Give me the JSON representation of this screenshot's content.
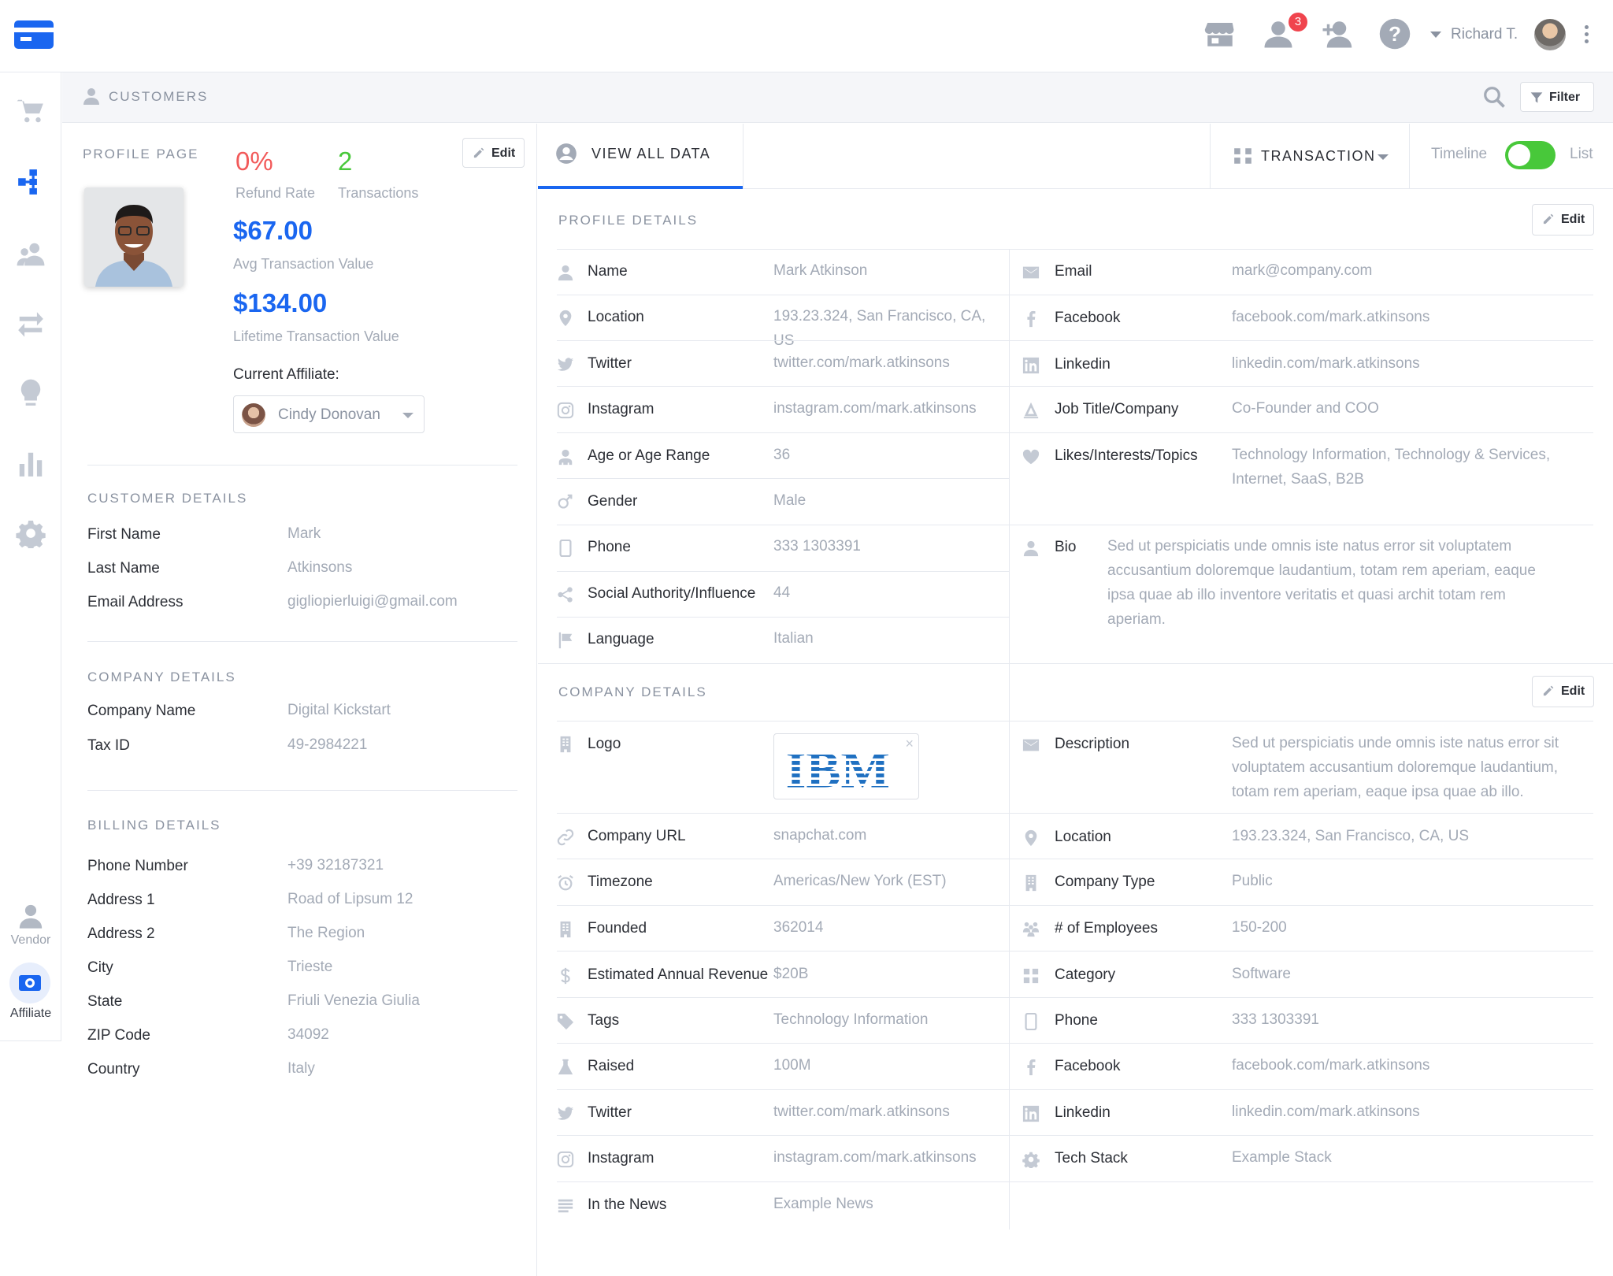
{
  "header": {
    "notifications_count": "3",
    "user_name": "Richard T."
  },
  "subheader": {
    "title": "CUSTOMERS",
    "filter_label": "Filter"
  },
  "sidebar": {
    "vendor_label": "Vendor",
    "affiliate_label": "Affiliate",
    "accent_color": "#1a66f0"
  },
  "profile": {
    "section_title": "PROFILE PAGE",
    "edit_label": "Edit",
    "refund_rate": "0%",
    "refund_rate_label": "Refund Rate",
    "transactions": "2",
    "transactions_label": "Transactions",
    "avg_value": "$67.00",
    "avg_label": "Avg Transaction Value",
    "lifetime_value": "$134.00",
    "lifetime_label": "Lifetime Transaction Value",
    "affiliate_title": "Current Affiliate:",
    "affiliate_name": "Cindy Donovan"
  },
  "customer_details": {
    "title": "CUSTOMER DETAILS",
    "rows": [
      {
        "label": "First Name",
        "value": "Mark"
      },
      {
        "label": "Last Name",
        "value": "Atkinsons"
      },
      {
        "label": "Email Address",
        "value": "gigliopierluigi@gmail.com"
      }
    ]
  },
  "company_details_left": {
    "title": "COMPANY DETAILS",
    "rows": [
      {
        "label": "Company Name",
        "value": "Digital Kickstart"
      },
      {
        "label": "Tax ID",
        "value": "49-2984221"
      }
    ]
  },
  "billing_details": {
    "title": "BILLING DETAILS",
    "rows": [
      {
        "label": "Phone Number",
        "value": "+39 32187321"
      },
      {
        "label": "Address 1",
        "value": "Road of Lipsum 12"
      },
      {
        "label": "Address 2",
        "value": "The Region"
      },
      {
        "label": "City",
        "value": "Trieste"
      },
      {
        "label": "State",
        "value": "Friuli Venezia Giulia"
      },
      {
        "label": "ZIP Code",
        "value": "34092"
      },
      {
        "label": "Country",
        "value": "Italy"
      }
    ]
  },
  "tabs": {
    "view_all": "VIEW ALL DATA",
    "transaction": "TRANSACTION",
    "timeline": "Timeline",
    "list": "List",
    "toggle_color": "#48c83a"
  },
  "profile_details": {
    "title": "PROFILE DETAILS",
    "edit_label": "Edit",
    "left": [
      {
        "icon": "user-icon",
        "label": "Name",
        "value": "Mark Atkinson"
      },
      {
        "icon": "location-pin-icon",
        "label": "Location",
        "value": "193.23.324, San Francisco, CA, US"
      },
      {
        "icon": "twitter-icon",
        "label": "Twitter",
        "value": "twitter.com/mark.atkinsons"
      },
      {
        "icon": "instagram-icon",
        "label": "Instagram",
        "value": "instagram.com/mark.atkinsons"
      },
      {
        "icon": "age-icon",
        "label": "Age or Age Range",
        "value": "36"
      },
      {
        "icon": "gender-icon",
        "label": "Gender",
        "value": "Male"
      },
      {
        "icon": "phone-icon",
        "label": "Phone",
        "value": "333 1303391"
      },
      {
        "icon": "share-icon",
        "label": "Social Authority/Influence",
        "value": "44"
      },
      {
        "icon": "flag-icon",
        "label": "Language",
        "value": "Italian"
      }
    ],
    "right": [
      {
        "icon": "mail-icon",
        "label": "Email",
        "value": "mark@company.com"
      },
      {
        "icon": "facebook-icon",
        "label": "Facebook",
        "value": "facebook.com/mark.atkinsons"
      },
      {
        "icon": "linkedin-icon",
        "label": "Linkedin",
        "value": "linkedin.com/mark.atkinsons"
      },
      {
        "icon": "job-icon",
        "label": "Job Title/Company",
        "value": "Co-Founder and COO"
      },
      {
        "icon": "heart-icon",
        "label": "Likes/Interests/Topics",
        "value": "Technology Information, Technology & Services, Internet, SaaS, B2B"
      },
      {
        "icon": "user-icon",
        "label": "Bio",
        "value": "Sed ut perspiciatis unde omnis iste natus error sit voluptatem accusantium doloremque laudantium, totam rem aperiam, eaque ipsa quae ab illo inventore veritatis et quasi archit totam rem aperiam."
      }
    ]
  },
  "company_details": {
    "title": "COMPANY DETAILS",
    "edit_label": "Edit",
    "logo_label": "Logo",
    "logo_text": "IBM",
    "left": [
      {
        "icon": "link-icon",
        "label": "Company URL",
        "value": "snapchat.com"
      },
      {
        "icon": "alarm-clock-icon",
        "label": "Timezone",
        "value": "Americas/New York (EST)"
      },
      {
        "icon": "building-icon",
        "label": "Founded",
        "value": "362014"
      },
      {
        "icon": "dollar-icon",
        "label": "Estimated Annual Revenue",
        "value": "$20B"
      },
      {
        "icon": "tag-icon",
        "label": "Tags",
        "value": "Technology Information"
      },
      {
        "icon": "flask-icon",
        "label": "Raised",
        "value": "100M"
      },
      {
        "icon": "twitter-icon",
        "label": "Twitter",
        "value": "twitter.com/mark.atkinsons"
      },
      {
        "icon": "instagram-icon",
        "label": "Instagram",
        "value": "instagram.com/mark.atkinsons"
      },
      {
        "icon": "news-icon",
        "label": "In the News",
        "value": "Example News"
      }
    ],
    "right": [
      {
        "icon": "mail-icon",
        "label": "Description",
        "value": "Sed ut perspiciatis unde omnis iste natus error sit voluptatem accusantium doloremque laudantium, totam rem aperiam, eaque ipsa quae ab illo."
      },
      {
        "icon": "location-pin-icon",
        "label": "Location",
        "value": "193.23.324, San Francisco, CA, US"
      },
      {
        "icon": "building-icon",
        "label": "Company Type",
        "value": "Public"
      },
      {
        "icon": "employees-icon",
        "label": "# of Employees",
        "value": "150-200"
      },
      {
        "icon": "grid-icon",
        "label": "Category",
        "value": "Software"
      },
      {
        "icon": "phone-icon",
        "label": "Phone",
        "value": "333 1303391"
      },
      {
        "icon": "facebook-icon",
        "label": "Facebook",
        "value": "facebook.com/mark.atkinsons"
      },
      {
        "icon": "linkedin-icon",
        "label": "Linkedin",
        "value": "linkedin.com/mark.atkinsons"
      },
      {
        "icon": "gear-icon",
        "label": "Tech Stack",
        "value": "Example Stack"
      }
    ]
  }
}
